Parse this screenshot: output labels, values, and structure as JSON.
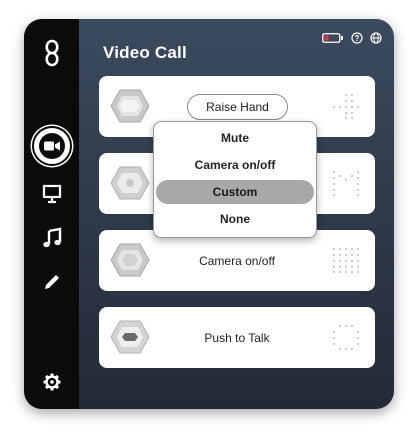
{
  "app": {
    "title": "Video Call"
  },
  "sidebar": {
    "items": [
      {
        "name": "logo",
        "icon": "infinity-logo-icon"
      },
      {
        "name": "video-call",
        "icon": "camera-icon",
        "active": true
      },
      {
        "name": "presentation",
        "icon": "presentation-icon"
      },
      {
        "name": "music",
        "icon": "music-note-icon"
      },
      {
        "name": "draw",
        "icon": "pencil-icon"
      },
      {
        "name": "settings",
        "icon": "gear-icon"
      }
    ]
  },
  "status_icons": [
    "battery-low-icon",
    "help-icon",
    "globe-icon"
  ],
  "colors": {
    "battery_low": "#e23a3a",
    "selected_item": "#a8a8a8",
    "panel_top": "#3b4a5e",
    "panel_bottom": "#222a36"
  },
  "cards": [
    {
      "label": "Raise Hand",
      "mode": "pill"
    },
    {
      "label": "",
      "mode": "text"
    },
    {
      "label": "Camera on/off",
      "mode": "text"
    },
    {
      "label": "Push to Talk",
      "mode": "text"
    }
  ],
  "dropdown": {
    "items": [
      {
        "label": "Mute",
        "selected": false
      },
      {
        "label": "Camera on/off",
        "selected": false
      },
      {
        "label": "Custom",
        "selected": true
      },
      {
        "label": "None",
        "selected": false
      }
    ]
  }
}
